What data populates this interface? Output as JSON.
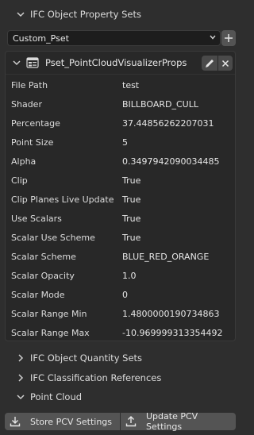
{
  "panel": {
    "title": "IFC Object Property Sets"
  },
  "pset_selector": {
    "value": "Custom_Pset",
    "add_label": "+"
  },
  "pset": {
    "name": "Pset_PointCloudVisualizerProps",
    "properties": [
      {
        "key": "File Path",
        "value": "test"
      },
      {
        "key": "Shader",
        "value": "BILLBOARD_CULL"
      },
      {
        "key": "Percentage",
        "value": "37.44856262207031"
      },
      {
        "key": "Point Size",
        "value": "5"
      },
      {
        "key": "Alpha",
        "value": "0.3497942090034485"
      },
      {
        "key": "Clip",
        "value": "True"
      },
      {
        "key": "Clip Planes Live Update",
        "value": "True"
      },
      {
        "key": "Use Scalars",
        "value": "True"
      },
      {
        "key": "Scalar Use Scheme",
        "value": "True"
      },
      {
        "key": "Scalar Scheme",
        "value": "BLUE_RED_ORANGE"
      },
      {
        "key": "Scalar Opacity",
        "value": "1.0"
      },
      {
        "key": "Scalar Mode",
        "value": "0"
      },
      {
        "key": "Scalar Range Min",
        "value": "1.4800000190734863"
      },
      {
        "key": "Scalar Range Max",
        "value": "-10.969999313354492"
      }
    ]
  },
  "sections": [
    {
      "label": "IFC Object Quantity Sets",
      "expanded": false
    },
    {
      "label": "IFC Classification References",
      "expanded": false
    },
    {
      "label": "Point Cloud",
      "expanded": true
    }
  ],
  "buttons": {
    "store": "Store PCV Settings",
    "update": "Update PCV Settings"
  }
}
